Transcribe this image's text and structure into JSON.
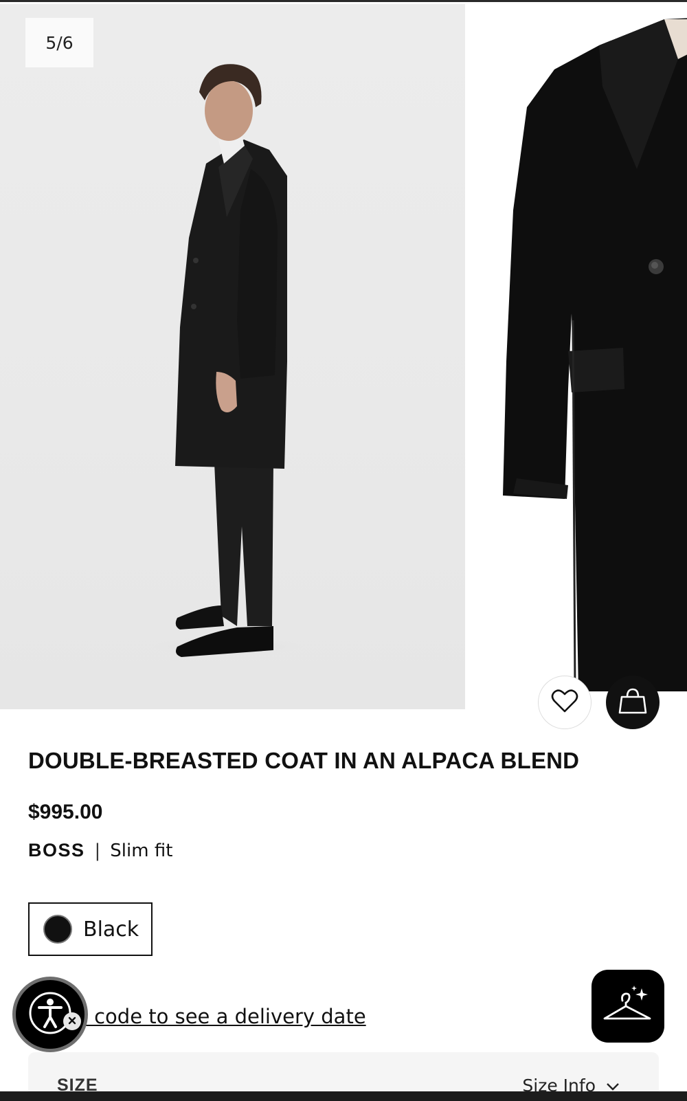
{
  "gallery": {
    "counter": "5/6"
  },
  "product": {
    "title": "DOUBLE-BREASTED COAT IN AN ALPACA BLEND",
    "price": "$995.00",
    "brand": "BOSS",
    "separator": "|",
    "fit": "Slim fit",
    "color": {
      "label": "Black",
      "swatch": "#111111"
    }
  },
  "actions": {
    "wishlist_icon": "heart-icon",
    "bag_icon": "shopping-bag-icon",
    "stylist_icon": "hanger-sparkle-icon",
    "accessibility_icon": "accessibility-person-icon"
  },
  "delivery": {
    "text": "a ZIP code to see a delivery date"
  },
  "size": {
    "label": "SIZE",
    "info": "Size Info"
  }
}
